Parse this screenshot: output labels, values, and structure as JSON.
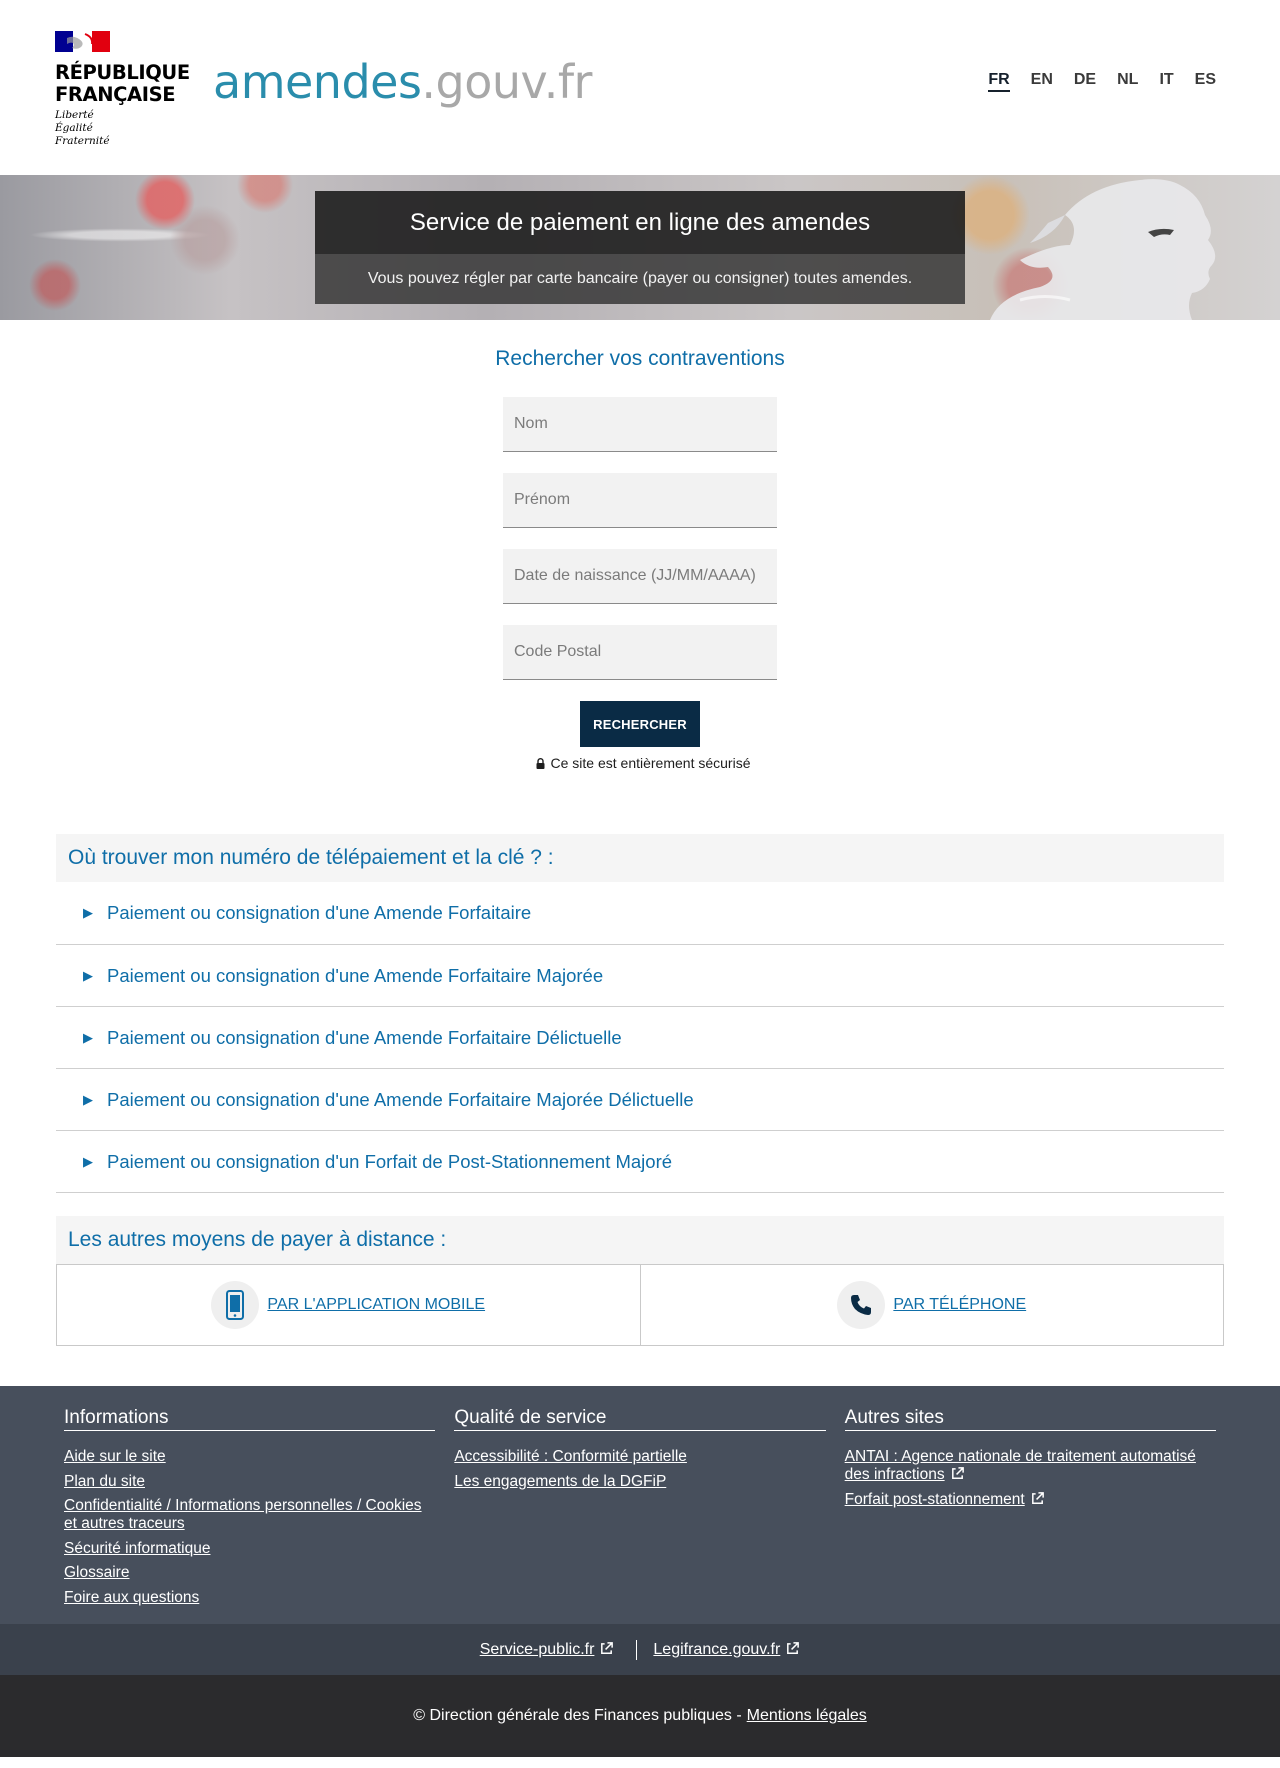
{
  "header": {
    "rf_title_line1": "RÉPUBLIQUE",
    "rf_title_line2": "FRANÇAISE",
    "motto_1": "Liberté",
    "motto_2": "Égalité",
    "motto_3": "Fraternité",
    "site_name_part1": "amendes",
    "site_name_part2": ".gouv.fr",
    "languages": [
      "FR",
      "EN",
      "DE",
      "NL",
      "IT",
      "ES"
    ],
    "active_language": "FR"
  },
  "hero": {
    "title": "Service de paiement en ligne des amendes",
    "subtitle": "Vous pouvez régler par carte bancaire (payer ou consigner) toutes amendes."
  },
  "search": {
    "title": "Rechercher vos contraventions",
    "nom_placeholder": "Nom",
    "prenom_placeholder": "Prénom",
    "dob_placeholder": "Date de naissance (JJ/MM/AAAA)",
    "cp_placeholder": "Code Postal",
    "button_label": "RECHERCHER",
    "secure_text": "Ce site est entièrement sécurisé"
  },
  "faq": {
    "title": "Où trouver mon numéro de télépaiement et la clé ? :",
    "items": [
      "Paiement ou consignation d'une Amende Forfaitaire",
      "Paiement ou consignation d'une Amende Forfaitaire Majorée",
      "Paiement ou consignation d'une Amende Forfaitaire Délictuelle",
      "Paiement ou consignation d'une Amende Forfaitaire Majorée Délictuelle",
      "Paiement ou consignation d'un Forfait de Post-Stationnement Majoré"
    ]
  },
  "other_means": {
    "title": "Les autres moyens de payer à distance :",
    "mobile_label": "PAR L'APPLICATION MOBILE",
    "phone_label": "PAR TÉLÉPHONE"
  },
  "footer": {
    "col1_title": "Informations",
    "col1_links": [
      "Aide sur le site",
      "Plan du site",
      "Confidentialité / Informations personnelles / Cookies et autres traceurs",
      "Sécurité informatique",
      "Glossaire",
      "Foire aux questions"
    ],
    "col2_title": "Qualité de service",
    "col2_links": [
      "Accessibilité : Conformité partielle",
      "Les engagements de la DGFiP"
    ],
    "col3_title": "Autres sites",
    "col3_links": [
      "ANTAI : Agence nationale de traitement automatisé des infractions",
      "Forfait post-stationnement"
    ],
    "mid_link_1": "Service-public.fr",
    "mid_link_2": "Legifrance.gouv.fr",
    "copyright": "© Direction générale des Finances publiques -",
    "legal_link": "Mentions légales"
  },
  "colors": {
    "brand_blue": "#0f6ea8",
    "button_navy": "#0a2b45",
    "footer_bg": "#474f5c"
  }
}
